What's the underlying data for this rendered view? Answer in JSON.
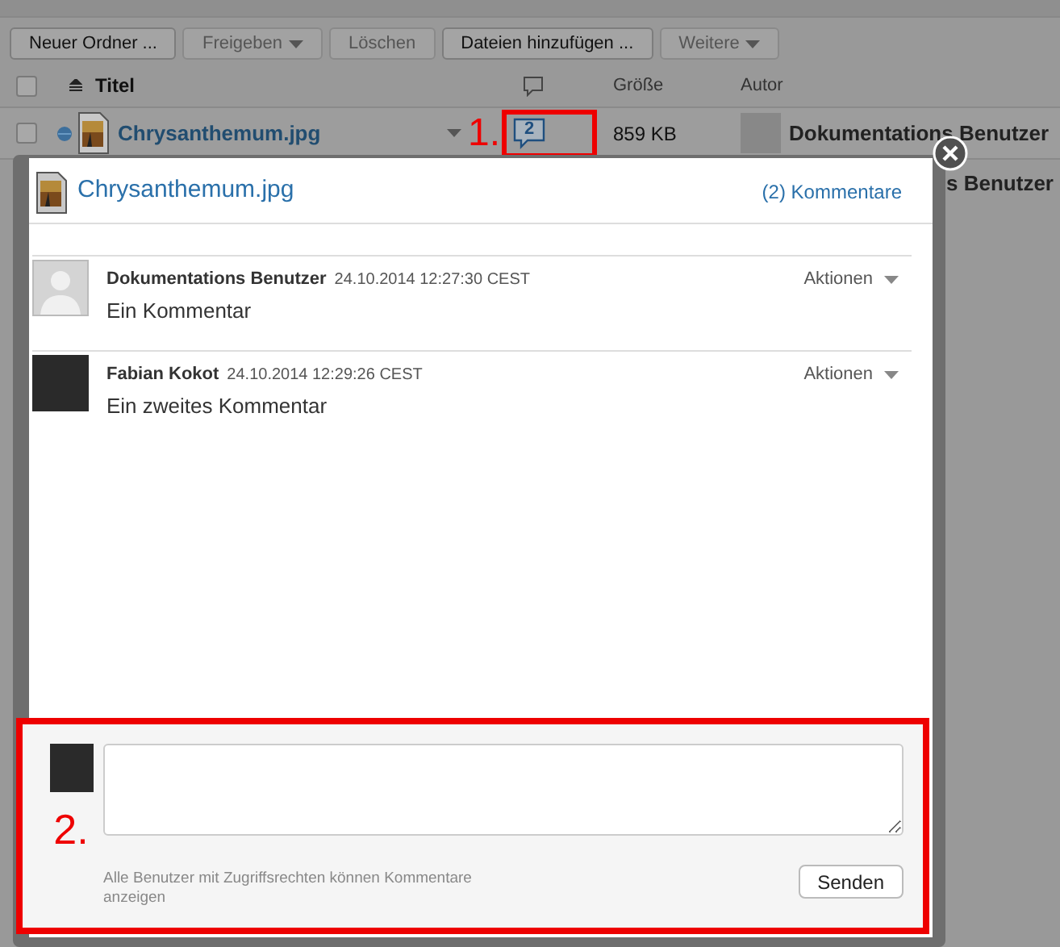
{
  "toolbar": [
    {
      "label": "Neuer Ordner ...",
      "disabled": false,
      "dropdown": false
    },
    {
      "label": "Freigeben",
      "disabled": true,
      "dropdown": true
    },
    {
      "label": "Löschen",
      "disabled": true,
      "dropdown": false
    },
    {
      "label": "Dateien hinzufügen ...",
      "disabled": false,
      "dropdown": false
    },
    {
      "label": "Weitere",
      "disabled": true,
      "dropdown": true
    }
  ],
  "table": {
    "select_all": {
      "checked": false
    },
    "columns": [
      "Titel",
      "Größe",
      "Autor"
    ],
    "rows": [
      {
        "title": "Chrysanthemum.jpg",
        "comments": "2",
        "size": "859 KB",
        "author": "Dokumentations Benutzer",
        "checked": false
      },
      {
        "author": "s Benutzer"
      }
    ]
  },
  "dialog": {
    "file_name": "Chrysanthemum.jpg",
    "comment_count": "(2) Kommentare",
    "comments": [
      {
        "author": "Dokumentations Benutzer",
        "time": "24.10.2014 12:27:30 CEST",
        "text": "Ein Kommentar",
        "actions": "Aktionen",
        "kind": "silhouette"
      },
      {
        "author": "Fabian Kokot",
        "time": "24.10.2014 12:29:26 CEST",
        "text": "Ein zweites Kommentar",
        "actions": "Aktionen",
        "kind": "photo"
      }
    ],
    "composer": {
      "note": "Alle Benutzer mit Zugriffsrechten können Kommentare anzeigen",
      "button": "Senden"
    }
  },
  "annotations": [
    {
      "label": "1."
    },
    {
      "label": "2."
    }
  ]
}
